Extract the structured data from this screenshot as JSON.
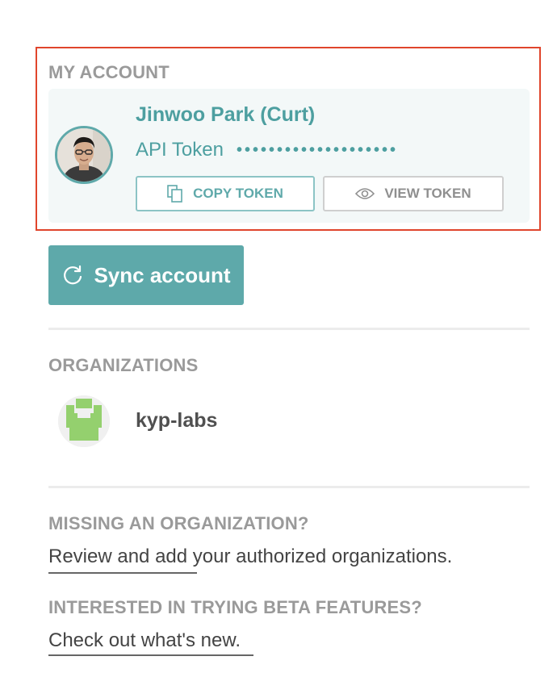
{
  "account": {
    "heading": "MY ACCOUNT",
    "user_name": "Jinwoo Park (Curt)",
    "token_label": "API Token",
    "token_mask": "••••••••••••••••••••",
    "copy_token_label": "COPY TOKEN",
    "view_token_label": "VIEW TOKEN",
    "avatar_icon": "user-photo"
  },
  "sync": {
    "label": "Sync account",
    "icon": "refresh-icon"
  },
  "organizations": {
    "heading": "ORGANIZATIONS",
    "items": [
      {
        "name": "kyp-labs",
        "avatar_icon": "green-pixel-identicon"
      }
    ]
  },
  "missing_org": {
    "heading": "MISSING AN ORGANIZATION?",
    "link_text": "Review and add",
    "trailing_text": " your authorized organizations."
  },
  "beta": {
    "heading": "INTERESTED IN TRYING BETA FEATURES?",
    "link_text": "Check out what's new."
  },
  "colors": {
    "accent": "#5ea9aa",
    "highlight": "#e0452c",
    "heading": "#9a9a9a",
    "card_bg": "#f3f8f8",
    "identicon": "#94d06e"
  }
}
